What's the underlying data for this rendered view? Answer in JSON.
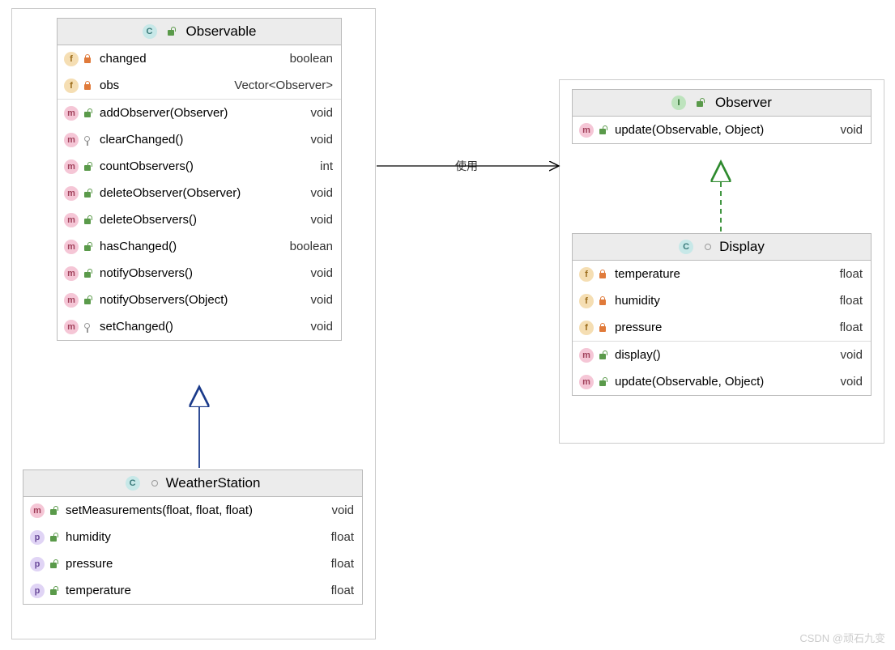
{
  "watermark": "CSDN @顽石九变",
  "relations": {
    "uses_label": "使用"
  },
  "boxes": {
    "observable": {
      "title": "Observable",
      "type_badge": "C",
      "fields": [
        {
          "kind": "f",
          "vis": "lock",
          "name": "changed",
          "type": "boolean"
        },
        {
          "kind": "f",
          "vis": "lock",
          "name": "obs",
          "type": "Vector<Observer>"
        }
      ],
      "methods": [
        {
          "kind": "m",
          "vis": "open",
          "name": "addObserver(Observer)",
          "type": "void"
        },
        {
          "kind": "m",
          "vis": "key",
          "name": "clearChanged()",
          "type": "void"
        },
        {
          "kind": "m",
          "vis": "open",
          "name": "countObservers()",
          "type": "int"
        },
        {
          "kind": "m",
          "vis": "open",
          "name": "deleteObserver(Observer)",
          "type": "void"
        },
        {
          "kind": "m",
          "vis": "open",
          "name": "deleteObservers()",
          "type": "void"
        },
        {
          "kind": "m",
          "vis": "open",
          "name": "hasChanged()",
          "type": "boolean"
        },
        {
          "kind": "m",
          "vis": "open",
          "name": "notifyObservers()",
          "type": "void"
        },
        {
          "kind": "m",
          "vis": "open",
          "name": "notifyObservers(Object)",
          "type": "void"
        },
        {
          "kind": "m",
          "vis": "key",
          "name": "setChanged()",
          "type": "void"
        }
      ]
    },
    "weatherstation": {
      "title": "WeatherStation",
      "type_badge": "C",
      "members": [
        {
          "kind": "m",
          "vis": "open",
          "name": "setMeasurements(float, float, float)",
          "type": "void"
        },
        {
          "kind": "p",
          "vis": "open",
          "name": "humidity",
          "type": "float"
        },
        {
          "kind": "p",
          "vis": "open",
          "name": "pressure",
          "type": "float"
        },
        {
          "kind": "p",
          "vis": "open",
          "name": "temperature",
          "type": "float"
        }
      ]
    },
    "observer": {
      "title": "Observer",
      "type_badge": "I",
      "members": [
        {
          "kind": "m",
          "vis": "open",
          "name": "update(Observable, Object)",
          "type": "void"
        }
      ]
    },
    "display": {
      "title": "Display",
      "type_badge": "C",
      "fields": [
        {
          "kind": "f",
          "vis": "lock",
          "name": "temperature",
          "type": "float"
        },
        {
          "kind": "f",
          "vis": "lock",
          "name": "humidity",
          "type": "float"
        },
        {
          "kind": "f",
          "vis": "lock",
          "name": "pressure",
          "type": "float"
        }
      ],
      "methods": [
        {
          "kind": "m",
          "vis": "open",
          "name": "display()",
          "type": "void"
        },
        {
          "kind": "m",
          "vis": "open",
          "name": "update(Observable, Object)",
          "type": "void"
        }
      ]
    }
  }
}
